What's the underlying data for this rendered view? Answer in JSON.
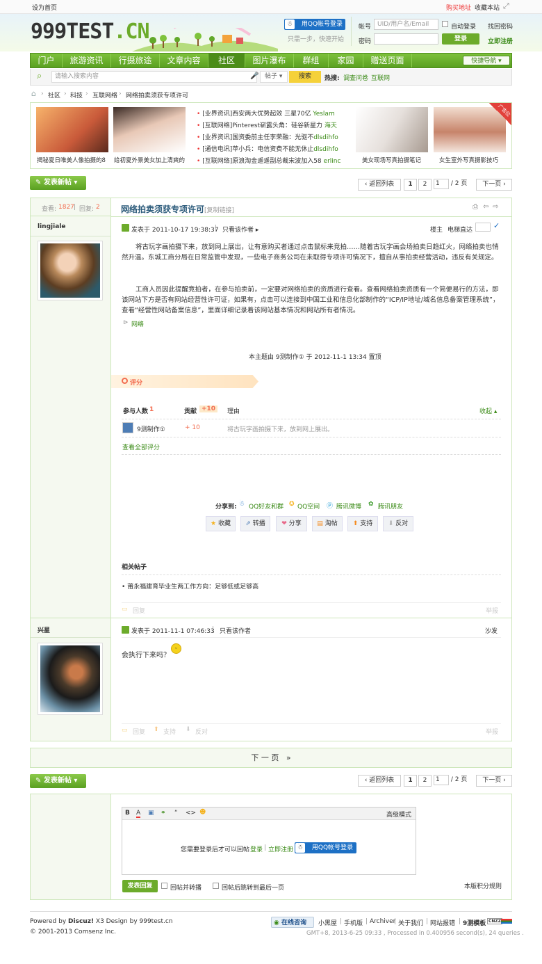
{
  "topbar": {
    "set_home": "设为首页",
    "buy_address": "购买地址",
    "bookmark": "收藏本站"
  },
  "logo": {
    "main": "999TEST",
    "suffix": ".CN"
  },
  "login": {
    "qq_login": "用QQ帐号登录",
    "qq_sub": "只需一步，快速开始",
    "account_label": "帐号",
    "account_placeholder": "UID/用户名/Email",
    "auto_login": "自动登录",
    "find_password": "找回密码",
    "password_label": "密码",
    "login_button": "登录",
    "register": "立即注册"
  },
  "nav": {
    "items": [
      "门户",
      "旅游资讯",
      "行摄旅途",
      "文章内容",
      "社区",
      "图片瀑布",
      "群组",
      "家园",
      "赠送页面"
    ],
    "quick": "快捷导航"
  },
  "search": {
    "placeholder": "请输入搜索内容",
    "type": "帖子",
    "button": "搜索",
    "hot_label": "热搜:",
    "hot1": "调查问卷",
    "hot2": "互联网"
  },
  "breadcrumb": [
    "社区",
    "科技",
    "互联网络",
    "网络拍卖须获专项许可"
  ],
  "ad": {
    "img1": "揭秘夏日唯美人像拍摄的8",
    "img2": "给初夏外景美女加上清爽的",
    "news": [
      {
        "text": "[业界资讯]西安两大优势起效 三星70亿",
        "author": "Yeslam"
      },
      {
        "text": "[互联网络]Pinterest崭露头角：硅谷新星力",
        "author": "海天"
      },
      {
        "text": "[业界资讯]国资委前主任李荣融：光驱不",
        "author": "dlsdihfo"
      },
      {
        "text": "[通信电讯]苹小兵：电信资费不能无休止",
        "author": "dlsdihfo"
      },
      {
        "text": "[互联网络]原浪淘金遥遥副总裁宋波加入58",
        "author": "erlinc"
      }
    ],
    "img3": "美女现场写真拍摄笔记",
    "img4": "女生室外写真摄影技巧",
    "corner": "广告位"
  },
  "toolbar": {
    "new_post": "发表新帖",
    "back_list": "返回列表",
    "page1": "1",
    "page2": "2",
    "page_current": "1",
    "page_total": "/ 2 页",
    "next": "下一页"
  },
  "post1": {
    "views_label": "查看:",
    "views": "1827",
    "replies_label": "回复:",
    "replies": "2",
    "title": "网络拍卖须获专项许可",
    "copy_link": "[复制链接]",
    "author": "lingjiale",
    "date": "发表于 2011-10-17 19:38:37",
    "only_author": "只看该作者",
    "floor": "楼主",
    "jump": "电梯直达",
    "para1": "将古玩字画拍摄下来，放到网上展出，让有意购买者通过点击鼠标来竞拍……随着古玩字画会场拍卖日趋红火，网络拍卖也悄然升温。东城工商分局在日常监管中发现，一些电子商务公司在未取得专项许可情况下，擅自从事拍卖经营活动，违反有关规定。",
    "para2": "工商人员因此提醒竞拍者，在参与拍卖前，一定要对网络拍卖的资质进行查看。查看网络拍卖资质有一个简便易行的方法，即该网站下方是否有网站经营性许可证，如果有，点击可以连接到中国工业和信息化部制作的“ICP/IP地址/域名信息备案管理系统”，查看“经营性网站备案信息”，里面详细记录着该网站基本情况和网站所有者情况。",
    "tag": "网络",
    "top_notice": "本主题由 9测制作① 于 2012-11-1 13:34 置顶"
  },
  "rating": {
    "title": "评分",
    "participants_label": "参与人数",
    "participants": "1",
    "contrib_label": "贡献",
    "contrib": "+10",
    "reason_label": "理由",
    "collapse": "收起",
    "user": "9测制作①",
    "score": "+ 10",
    "reason": "将古玩字画拍摄下来，放到网上展出。",
    "view_all": "查看全部评分"
  },
  "share": {
    "label": "分享到:",
    "qq_friends": "QQ好友和群",
    "qzone": "QQ空间",
    "tencent_weibo": "腾讯微博",
    "tencent_friends": "腾讯朋友"
  },
  "actions": {
    "fav": "收藏",
    "repost": "转播",
    "share": "分享",
    "taobao": "淘帖",
    "support": "支持",
    "oppose": "反对"
  },
  "related": {
    "title": "相关帖子",
    "item1": "莆永福建育毕业生两工作方向：足够低或足够高"
  },
  "postfoot": {
    "reply": "回复",
    "report": "举报"
  },
  "post2": {
    "author": "兴星",
    "date": "发表于 2011-11-1 07:46:33",
    "only_author": "只看该作者",
    "floor": "沙发",
    "content": "会执行下来吗？",
    "reply": "回复",
    "support": "支持",
    "oppose": "反对",
    "report": "举报"
  },
  "next_page": {
    "text": "下 一 页",
    "arrow": "»"
  },
  "editor": {
    "bold": "B",
    "font": "A",
    "advanced": "高级模式",
    "login_notice": "您需要登录后才可以回帖",
    "login": "登录",
    "register": "立即注册",
    "qq_login": "用QQ帐号登录",
    "submit": "发表回复",
    "opt1": "回帖并转播",
    "opt2": "回帖后跳转到最后一页",
    "credit_rules": "本版积分规则"
  },
  "footer": {
    "powered": "Powered by",
    "discuz": "Discuz!",
    "x3": "X3 Design by 999test.cn",
    "copy": "© 2001-2013 Comsenz Inc.",
    "online": "在线咨询",
    "links": [
      "小黑屋",
      "手机版",
      "Archiver",
      "关于我们",
      "网站报错",
      "9测模板"
    ],
    "cnzz": "CNZZ",
    "time": "GMT+8, 2013-6-25 09:33 , Processed in 0.400956 second(s), 24 queries ."
  }
}
